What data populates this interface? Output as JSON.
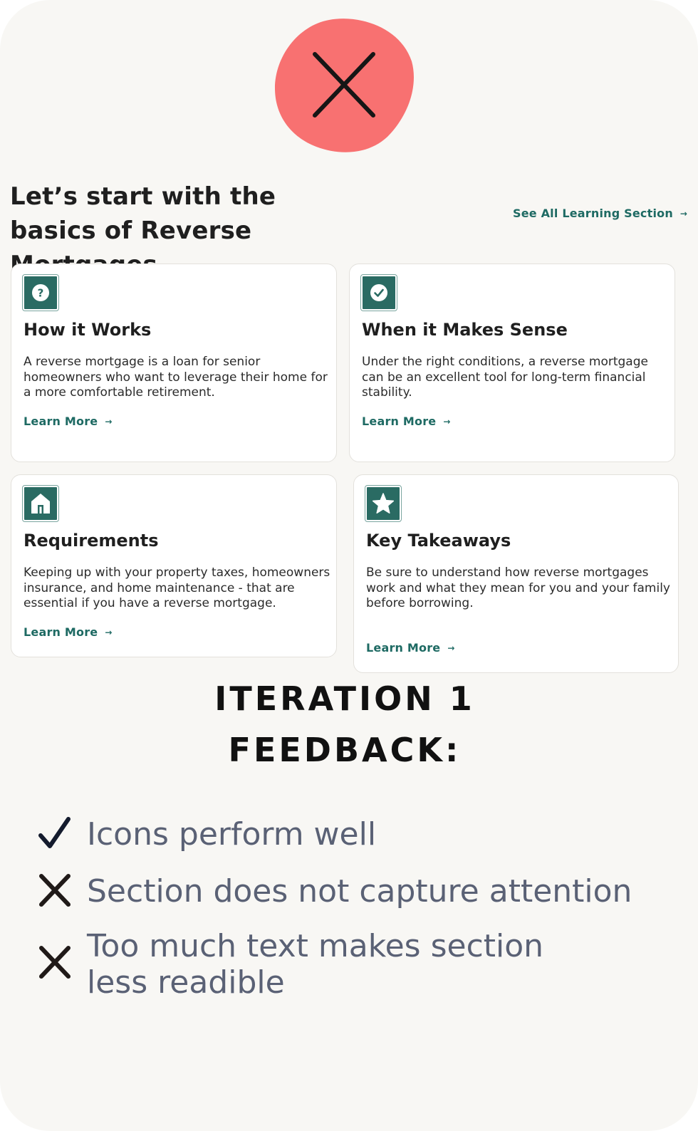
{
  "header": {
    "status_icon": "x-mark-icon",
    "status_color": "#f87171",
    "title": "Let’s start with the basics of Reverse Mortgages",
    "see_all_label": "See All Learning Section",
    "see_all_arrow": "→"
  },
  "cards": [
    {
      "icon": "question-icon",
      "title": "How it Works",
      "description": "A reverse mortgage is a loan for senior homeowners who want to leverage their home for a more comfortable retirement.",
      "link_label": "Learn More",
      "link_arrow": "→"
    },
    {
      "icon": "check-circle-icon",
      "title": "When it Makes Sense",
      "description": "Under the right conditions, a reverse mortgage can be an excellent tool for long-term financial stability.",
      "link_label": "Learn More",
      "link_arrow": "→"
    },
    {
      "icon": "home-icon",
      "title": "Requirements",
      "description": "Keeping up with your property taxes, homeowners insurance, and home maintenance - that are essential if you have a reverse mortgage.",
      "link_label": "Learn More",
      "link_arrow": "→"
    },
    {
      "icon": "star-icon",
      "title": "Key Takeaways",
      "description": "Be sure to understand how reverse mortgages work and what they mean for you and your family before borrowing.",
      "link_label": "Learn More",
      "link_arrow": "→"
    }
  ],
  "feedback": {
    "title_line1": "ITERATION 1",
    "title_line2": "FEEDBACK:",
    "items": [
      {
        "icon": "checkmark-icon",
        "text": "Icons perform well"
      },
      {
        "icon": "x-mark-icon",
        "text": "Section does not capture attention"
      },
      {
        "icon": "x-mark-icon",
        "text": "Too much text makes section less readible"
      }
    ]
  },
  "colors": {
    "accent": "#2a6b63",
    "link": "#1e6a63",
    "background": "#f8f7f4",
    "feedback_text": "#5a6175"
  }
}
